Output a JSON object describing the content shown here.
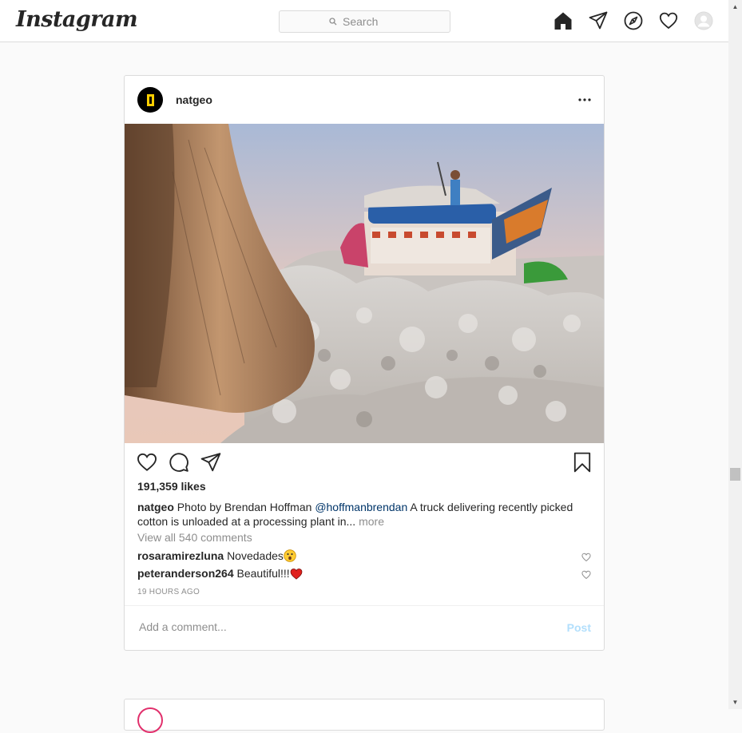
{
  "header": {
    "logo": "Instagram",
    "search_placeholder": "Search",
    "icons": [
      "home-icon",
      "direct-icon",
      "explore-icon",
      "activity-heart-icon",
      "profile-avatar-icon"
    ]
  },
  "post": {
    "username": "natgeo",
    "likes": "191,359 likes",
    "caption": {
      "username": "natgeo",
      "text_before": "Photo by Brendan Hoffman",
      "mention": "@hoffmanbrendan",
      "text_after": "A truck delivering recently picked cotton is unloaded at a processing plant in...",
      "more": "more"
    },
    "view_all": "View all 540 comments",
    "comments": [
      {
        "username": "rosaramirezluna",
        "text": "Novedades",
        "emoji": "astonished-face-emoji"
      },
      {
        "username": "peteranderson264",
        "text": "Beautiful!!!",
        "emoji": "red-heart-emoji"
      }
    ],
    "timestamp": "19 HOURS AGO",
    "add_comment_placeholder": "Add a comment...",
    "post_button": "Post"
  },
  "colors": {
    "link": "#003569",
    "post_button_disabled": "#b2dffc",
    "natgeo_yellow": "#ffce00",
    "border": "#dbdbdb",
    "background": "#fafafa"
  }
}
